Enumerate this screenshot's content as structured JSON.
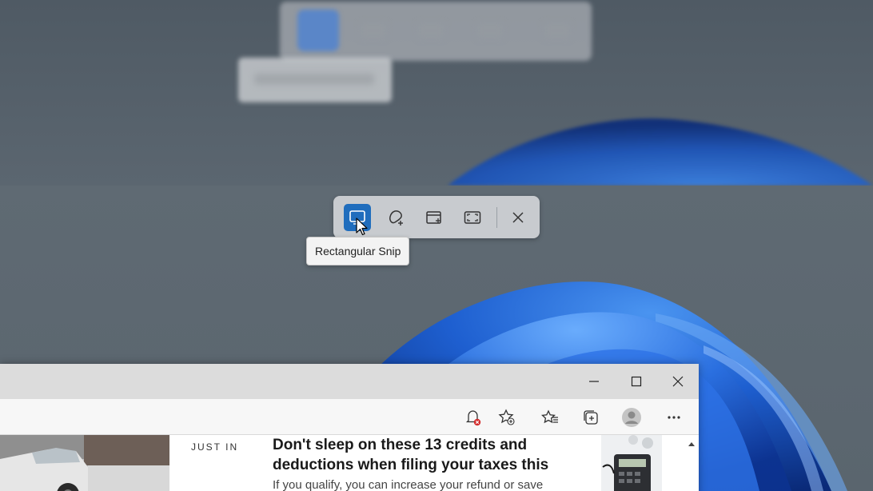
{
  "snip_toolbar": {
    "tools": [
      {
        "name": "rectangular-snip",
        "icon": "rectangle-snip-icon",
        "active": true
      },
      {
        "name": "freeform-snip",
        "icon": "freeform-snip-icon",
        "active": false
      },
      {
        "name": "window-snip",
        "icon": "window-snip-icon",
        "active": false
      },
      {
        "name": "fullscreen-snip",
        "icon": "fullscreen-snip-icon",
        "active": false
      }
    ],
    "close_icon": "close-icon",
    "tooltip": "Rectangular Snip",
    "accent_color": "#1f6dbd"
  },
  "browser": {
    "window_buttons": [
      "minimize-icon",
      "maximize-icon",
      "close-icon"
    ],
    "toolbar_icons": [
      "notification-bell-icon",
      "add-favorite-icon",
      "favorites-icon",
      "collections-icon",
      "profile-icon",
      "more-icon"
    ],
    "article": {
      "tag": "JUST IN",
      "headline": "Don't sleep on these 13 credits and deductions when filing your taxes this",
      "summary": "If you qualify, you can increase your refund or save"
    }
  }
}
